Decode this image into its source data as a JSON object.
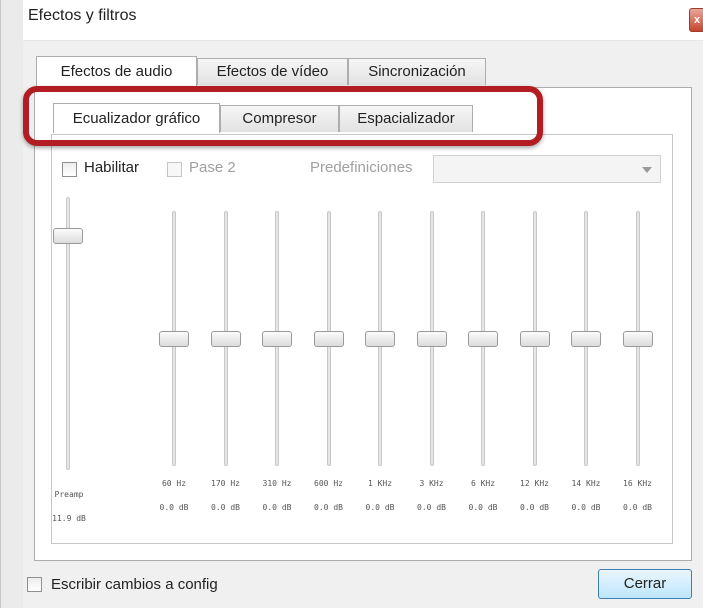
{
  "window": {
    "title": "Efectos y filtros",
    "close_glyph": "x"
  },
  "outer_tabs": [
    {
      "label": "Efectos de audio"
    },
    {
      "label": "Efectos de vídeo"
    },
    {
      "label": "Sincronización"
    }
  ],
  "inner_tabs": [
    {
      "label": "Ecualizador gráfico"
    },
    {
      "label": "Compresor"
    },
    {
      "label": "Espacializador"
    }
  ],
  "controls": {
    "enable_label": "Habilitar",
    "pass2_label": "Pase 2",
    "presets_label": "Predefiniciones",
    "presets_value": ""
  },
  "preamp": {
    "label": "Preamp",
    "value": "11.9 dB",
    "level": 0.8
  },
  "bands": [
    {
      "freq": "60 Hz",
      "gain": "0.0 dB",
      "level": 0.5
    },
    {
      "freq": "170 Hz",
      "gain": "0.0 dB",
      "level": 0.5
    },
    {
      "freq": "310 Hz",
      "gain": "0.0 dB",
      "level": 0.5
    },
    {
      "freq": "600 Hz",
      "gain": "0.0 dB",
      "level": 0.5
    },
    {
      "freq": "1 KHz",
      "gain": "0.0 dB",
      "level": 0.5
    },
    {
      "freq": "3 KHz",
      "gain": "0.0 dB",
      "level": 0.5
    },
    {
      "freq": "6 KHz",
      "gain": "0.0 dB",
      "level": 0.5
    },
    {
      "freq": "12 KHz",
      "gain": "0.0 dB",
      "level": 0.5
    },
    {
      "freq": "14 KHz",
      "gain": "0.0 dB",
      "level": 0.5
    },
    {
      "freq": "16 KHz",
      "gain": "0.0 dB",
      "level": 0.5
    }
  ],
  "footer": {
    "write_config_label": "Escribir cambios a config",
    "close_button": "Cerrar"
  },
  "colors": {
    "highlight": "#b11d22",
    "accent": "#3c7fb1"
  }
}
